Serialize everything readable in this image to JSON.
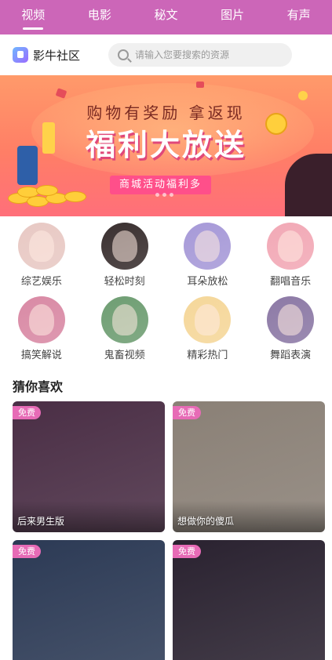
{
  "tabs": [
    {
      "label": "视频",
      "active": true
    },
    {
      "label": "电影",
      "active": false
    },
    {
      "label": "秘文",
      "active": false
    },
    {
      "label": "图片",
      "active": false
    },
    {
      "label": "有声",
      "active": false
    }
  ],
  "header": {
    "app_name": "影牛社区",
    "search_placeholder": "请输入您要搜索的资源"
  },
  "banner": {
    "line1": "购物有奖励 拿返现",
    "line2": "福利大放送",
    "tag": "商城活动福利多"
  },
  "categories": [
    {
      "label": "综艺娱乐",
      "color": "#e8c9c4"
    },
    {
      "label": "轻松时刻",
      "color": "#3a3030"
    },
    {
      "label": "耳朵放松",
      "color": "#a79ad8"
    },
    {
      "label": "翻唱音乐",
      "color": "#f2a9b6"
    },
    {
      "label": "搞笑解说",
      "color": "#d98aa5"
    },
    {
      "label": "鬼畜视频",
      "color": "#6f9e73"
    },
    {
      "label": "精彩热门",
      "color": "#f5d79a"
    },
    {
      "label": "舞蹈表演",
      "color": "#8d7aa6"
    }
  ],
  "recommend": {
    "title": "猜你喜欢",
    "items": [
      {
        "badge": "免费",
        "title": "后来男生版",
        "color": "#4a2e45"
      },
      {
        "badge": "免费",
        "title": "想做你的傻瓜",
        "color": "#8a8076"
      },
      {
        "badge": "免费",
        "title": "",
        "color": "#2c3a55"
      },
      {
        "badge": "免费",
        "title": "",
        "color": "#2a2230"
      }
    ]
  }
}
